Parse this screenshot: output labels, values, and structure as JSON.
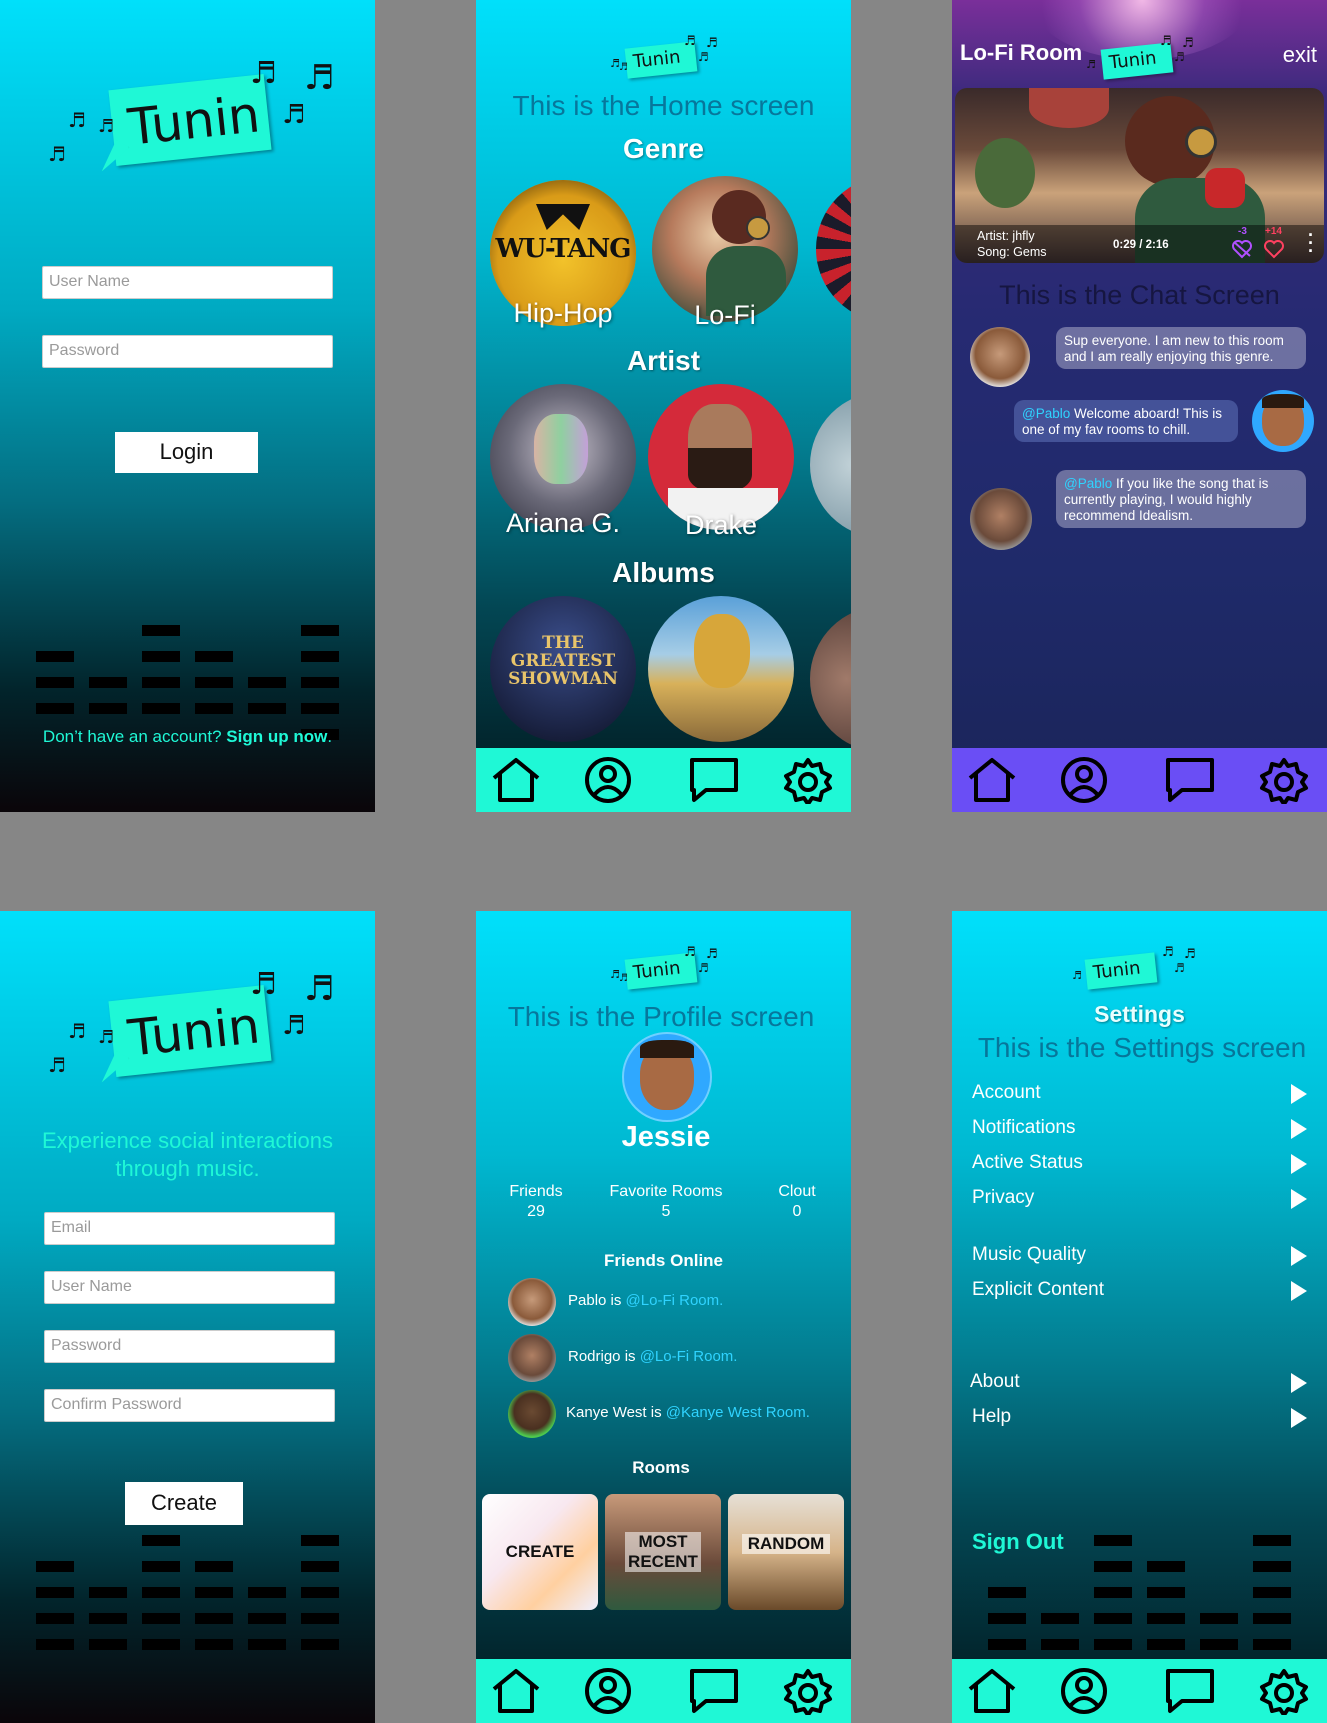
{
  "logo": {
    "text": "Tunin"
  },
  "login": {
    "username_placeholder": "User Name",
    "password_placeholder": "Password",
    "login_label": "Login",
    "signup_prompt": "Don’t have an account?",
    "signup_link": "Sign up now",
    "signup_end": "."
  },
  "home": {
    "screen_title": "This is the Home screen",
    "genre_heading": "Genre",
    "genres": [
      "Hip-Hop",
      "Lo-Fi"
    ],
    "artist_heading": "Artist",
    "artists": [
      "Ariana G.",
      "Drake"
    ],
    "albums_heading": "Albums",
    "album_texts": {
      "greatest_showman": "THE GREATEST SHOWMAN",
      "wutang": "WU-TANG"
    }
  },
  "room": {
    "title": "Lo-Fi Room",
    "exit_label": "exit",
    "artist": "Artist: jhfly",
    "song": "Song: Gems",
    "time": "0:29 / 2:16",
    "dislikes": "-3",
    "likes": "+14",
    "screen_title": "This is the Chat Screen",
    "messages": [
      {
        "mention": "",
        "text": "Sup everyone. I am new to this room and I am really enjoying this genre."
      },
      {
        "mention": "@Pablo",
        "text": " Welcome aboard! This is one of my fav rooms to chill."
      },
      {
        "mention": "@Pablo",
        "text": " If you like the song that is currently playing, I would highly recommend Idealism."
      }
    ]
  },
  "signup": {
    "tagline": "Experience social interactions through music.",
    "email_placeholder": "Email",
    "username_placeholder": "User Name",
    "password_placeholder": "Password",
    "confirm_placeholder": "Confirm Password",
    "create_label": "Create"
  },
  "profile": {
    "screen_title": "This is the Profile screen",
    "name": "Jessie",
    "stats": [
      {
        "label": "Friends",
        "value": "29"
      },
      {
        "label": "Favorite Rooms",
        "value": "5"
      },
      {
        "label": "Clout",
        "value": "0"
      }
    ],
    "friends_heading": "Friends Online",
    "friends": [
      {
        "status": "Pablo is ",
        "room": "@Lo-Fi Room."
      },
      {
        "status": "Rodrigo is ",
        "room": "@Lo-Fi Room."
      },
      {
        "status": "Kanye West is ",
        "room": "@Kanye West Room."
      }
    ],
    "rooms_heading": "Rooms",
    "rooms": [
      "CREATE",
      "MOST RECENT",
      "RANDOM"
    ]
  },
  "settings": {
    "heading": "Settings",
    "screen_title": "This is the Settings screen",
    "items": [
      "Account",
      "Notifications",
      "Active Status",
      "Privacy",
      "Music Quality",
      "Explicit Content",
      "About",
      "Help"
    ],
    "sign_out": "Sign Out"
  },
  "nav": {
    "icons": [
      "home-icon",
      "profile-icon",
      "chat-icon",
      "settings-icon"
    ]
  },
  "colors": {
    "accent": "#1ff8d6",
    "room_nav": "#6a4ef5",
    "link": "#2fd3ff"
  }
}
